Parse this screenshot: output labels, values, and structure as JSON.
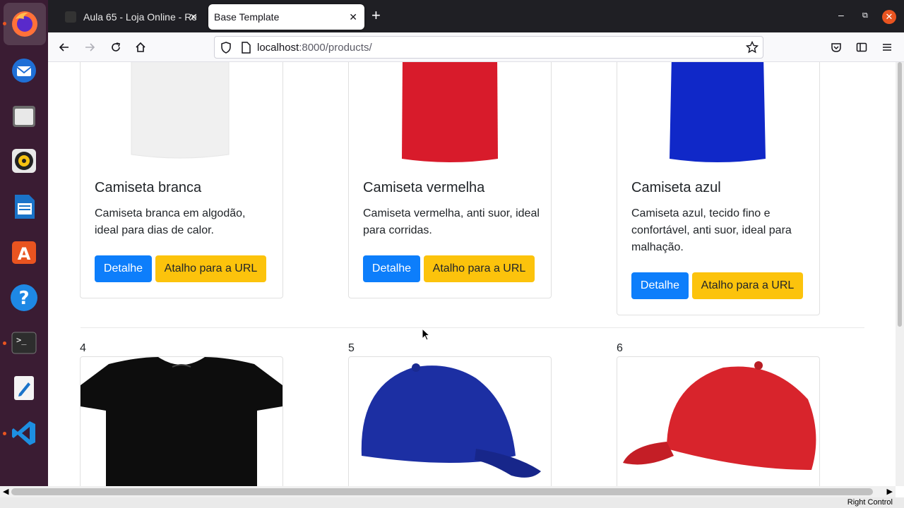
{
  "browser": {
    "tabs": [
      {
        "title": "Aula 65 - Loja Online - Re",
        "active": false
      },
      {
        "title": "Base Template",
        "active": true
      }
    ],
    "url_host": "localhost",
    "url_rest": ":8000/products/"
  },
  "dock": {
    "apps": [
      "firefox-icon",
      "thunderbird-icon",
      "files-icon",
      "rhythmbox-icon",
      "writer-icon",
      "app-center-icon",
      "help-icon",
      "terminal-icon",
      "text-editor-icon",
      "vscode-icon"
    ]
  },
  "products": [
    {
      "title": "Camiseta branca",
      "text": "Camiseta branca em algodão, ideal para dias de calor.",
      "color": "#f2f2f2"
    },
    {
      "title": "Camiseta vermelha",
      "text": "Camiseta vermelha, anti suor, ideal para corridas.",
      "color": "#d81b2b"
    },
    {
      "title": "Camiseta azul",
      "text": "Camiseta azul, tecido fino e confortável, anti suor, ideal para malhação.",
      "color": "#1028c8"
    }
  ],
  "buttons": {
    "detail": "Detalhe",
    "url_shortcut": "Atalho para a URL"
  },
  "next_row": [
    {
      "number": "4",
      "item": "black-tshirt"
    },
    {
      "number": "5",
      "item": "blue-cap"
    },
    {
      "number": "6",
      "item": "red-cap"
    }
  ],
  "status": {
    "text": "Right Control"
  }
}
